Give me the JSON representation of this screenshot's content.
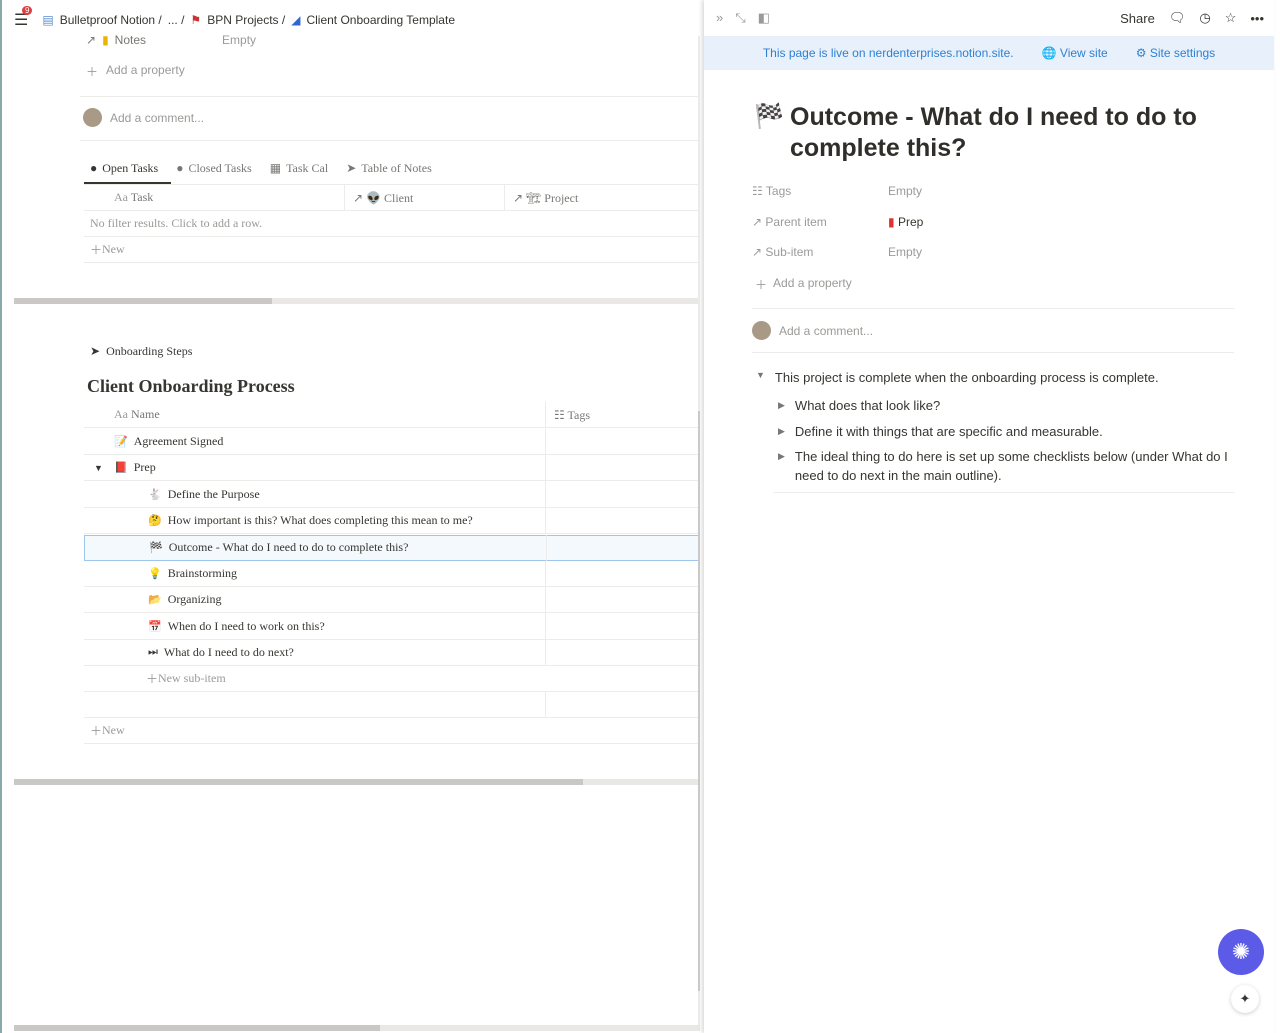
{
  "breadcrumb": {
    "badge": "9",
    "items": [
      "Bulletproof Notion /",
      "... /",
      "BPN Projects /",
      "Client Onboarding Template"
    ]
  },
  "left": {
    "notes_label": "Notes",
    "notes_value": "Empty",
    "add_property": "Add a property",
    "add_comment": "Add a comment...",
    "tabs": [
      "Open Tasks",
      "Closed Tasks",
      "Task Cal",
      "Table of Notes"
    ],
    "task_columns": [
      "Task",
      "Client",
      "Project"
    ],
    "no_results": "No filter results. Click to add a row.",
    "new": "New",
    "view_name": "Onboarding Steps",
    "db_title": "Client Onboarding Process",
    "columns": [
      "Name",
      "Tags"
    ],
    "rows": [
      {
        "icon": "📝",
        "name": "Agreement Signed"
      },
      {
        "icon": "📕",
        "name": "Prep"
      },
      {
        "icon": "🐇",
        "name": "Define the Purpose"
      },
      {
        "icon": "🤔",
        "name": "How important is this? What does completing this mean to me?"
      },
      {
        "icon": "🏁",
        "name": "Outcome - What do I need to do to complete this?"
      },
      {
        "icon": "💡",
        "name": "Brainstorming"
      },
      {
        "icon": "📂",
        "name": "Organizing"
      },
      {
        "icon": "📅",
        "name": "When do I need to work on this?"
      },
      {
        "icon": "⏭",
        "name": "What do I need to do next?"
      }
    ],
    "new_subitem": "New sub-item",
    "new_row": "New"
  },
  "right": {
    "share": "Share",
    "banner": "This page is live on nerdenterprises.notion.site.",
    "view_site": "View site",
    "site_settings": "Site settings",
    "title": "Outcome - What do I need to do to complete this?",
    "props": [
      {
        "k": "Tags",
        "v": "Empty"
      },
      {
        "k": "Parent item",
        "v": "Prep"
      },
      {
        "k": "Sub-item",
        "v": "Empty"
      }
    ],
    "add_property": "Add a property",
    "add_comment": "Add a comment...",
    "toggle": "This project is complete when the onboarding process is complete.",
    "children": [
      "What does that look like?",
      "Define it with things that are specific and measurable.",
      "The ideal thing to do here is set up some checklists below (under What do I need to do next in the main outline)."
    ]
  }
}
